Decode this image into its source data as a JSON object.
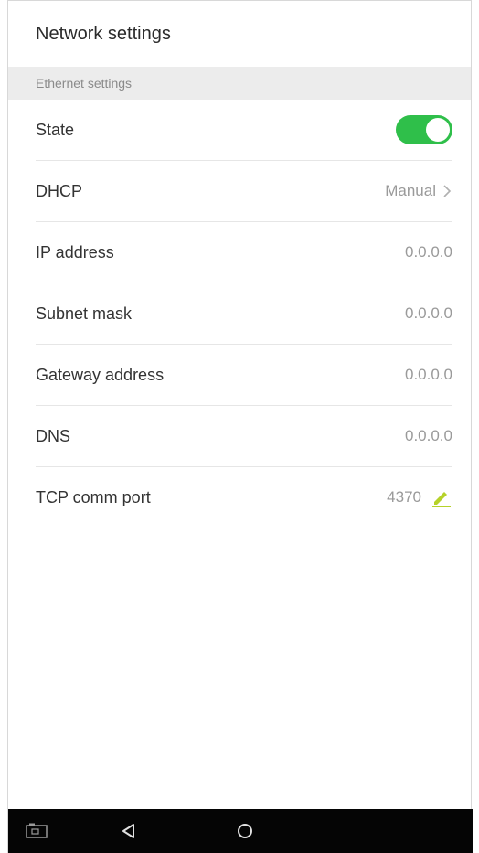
{
  "header": {
    "title": "Network settings"
  },
  "section": {
    "label": "Ethernet settings"
  },
  "rows": [
    {
      "label": "State",
      "value": ""
    },
    {
      "label": "DHCP",
      "value": "Manual"
    },
    {
      "label": "IP address",
      "value": "0.0.0.0"
    },
    {
      "label": "Subnet mask",
      "value": "0.0.0.0"
    },
    {
      "label": "Gateway address",
      "value": "0.0.0.0"
    },
    {
      "label": "DNS",
      "value": "0.0.0.0"
    },
    {
      "label": "TCP comm port",
      "value": "4370"
    }
  ],
  "state": {
    "on": true
  },
  "colors": {
    "toggle_on": "#2fbf4a",
    "edit_icon": "#b6d22a",
    "navbar": "#050505"
  },
  "icons": {
    "dhcp": "chevron-right-icon",
    "tcp": "pencil-icon",
    "nav": [
      "screenshot-icon",
      "back-icon",
      "home-icon"
    ]
  }
}
